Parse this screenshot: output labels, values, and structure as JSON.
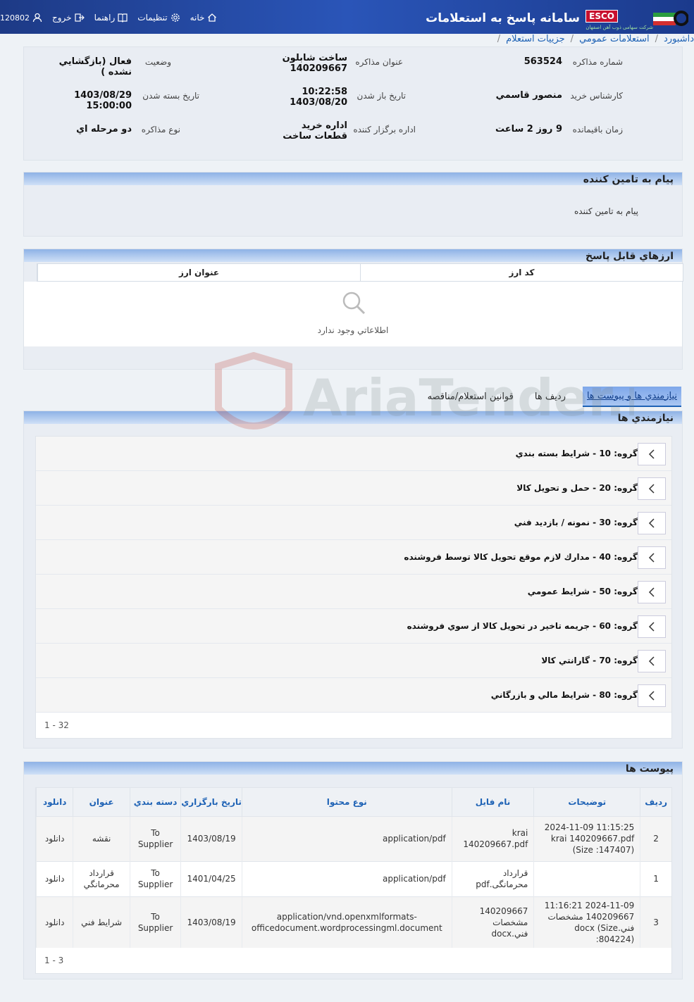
{
  "header": {
    "title": "سامانه پاسخ به استعلامات",
    "brand": "ESCO",
    "brand_sub": "شرکت سهامی ذوب آهن اصفهان",
    "user_code": "120802",
    "links": {
      "logout": "خروج",
      "help": "راهنما",
      "settings": "تنظیمات",
      "home": "خانه"
    }
  },
  "breadcrumb": [
    "داشبورد",
    "استعلامات عمومي",
    "جزييات استعلام"
  ],
  "info": {
    "negotiation_number_label": "شماره مذاکره",
    "negotiation_number": "563524",
    "negotiation_title_label": "عنوان مذاکره",
    "negotiation_title": "ساخت شابلون 140209667",
    "status_label": "وضعيت",
    "status": "فعال (بازگشايي نشده )",
    "buyer_label": "کارشناس خريد",
    "buyer": "منصور قاسمي",
    "open_date_label": "تاريخ باز شدن",
    "open_date": "10:22:58 1403/08/20",
    "close_date_label": "تاريخ بسته شدن",
    "close_date": "1403/08/29 15:00:00",
    "remaining_label": "زمان باقيمانده",
    "remaining": "9 روز 2 ساعت",
    "org_label": "اداره برگزار کننده",
    "org": "اداره خريد قطعات ساخت",
    "type_label": "نوع مذاکره",
    "type": "دو مرحله اي"
  },
  "message": {
    "title": "پيام به تامين کننده",
    "text": "پيام به تامين کننده"
  },
  "currencies": {
    "title": "ارزهاي قابل پاسخ",
    "col_code": "کد ارز",
    "col_title": "عنوان ارز",
    "empty": "اطلاعاتي وجود ندارد"
  },
  "tabs": [
    "نيازمندي ها و پيوست ها",
    "رديف ها",
    "قوانين استعلام/مناقصه"
  ],
  "requirements": {
    "title": "نيازمندي ها",
    "groups": [
      "گروه: 10 - شرايط بسته بندي",
      "گروه: 20 - حمل و تحويل کالا",
      "گروه: 30 - نمونه / بازديد فني",
      "گروه: 40 - مدارك لازم موقع تحويل كالا توسط فروشنده",
      "گروه: 50 - شرايط عمومي",
      "گروه: 60 - جريمه تاخير در تحويل کالا از سوي فروشنده",
      "گروه: 70 - گارانتي کالا",
      "گروه: 80 - شرايط مالي و بازرگاني"
    ],
    "pager": "1 - 32"
  },
  "attachments": {
    "title": "پيوست ها",
    "columns": [
      "رديف",
      "توضيحات",
      "نام فايل",
      "نوع محتوا",
      "تاريخ بارگزاري",
      "دسته بندي",
      "عنوان",
      "دانلود"
    ],
    "rows": [
      {
        "idx": "2",
        "desc": "2024-11-09 11:15:25 krai 140209667.pdf (Size :147407)",
        "file": "krai 140209667.pdf",
        "type": "application/pdf",
        "date": "1403/08/19",
        "cat": "To Supplier",
        "title": "نقشه",
        "dl": "دانلود"
      },
      {
        "idx": "1",
        "desc": "",
        "file": "قرارداد محرمانگی.pdf",
        "type": "application/pdf",
        "date": "1401/04/25",
        "cat": "To Supplier",
        "title": "قرارداد محرمانگي",
        "dl": "دانلود"
      },
      {
        "idx": "3",
        "desc": "2024-11-09 11:16:21 140209667 مشخصات فني.docx (Size :804224)",
        "file": "140209667 مشخصات فني.docx",
        "type": "application/vnd.openxmlformats-officedocument.wordprocessingml.document",
        "date": "1403/08/19",
        "cat": "To Supplier",
        "title": "شرايط فني",
        "dl": "دانلود"
      }
    ],
    "pager": "1 - 3"
  },
  "watermark": "AriaTender.neT",
  "colors": {
    "header_bg": "#2a55b8",
    "link": "#1e62b5",
    "brand_red": "#c8102e"
  }
}
